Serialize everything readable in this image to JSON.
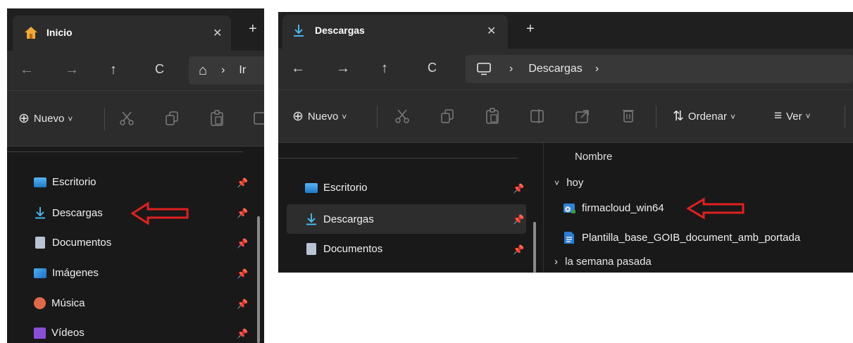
{
  "left_window": {
    "tab": {
      "title": "Inicio",
      "icon": "home-icon",
      "close_glyph": "✕",
      "newtab_glyph": "+"
    },
    "nav": {
      "back": "←",
      "forward": "→",
      "up": "↑",
      "refresh": "C",
      "home_glyph": "⌂",
      "chevron": "›",
      "path_partial": "Ir"
    },
    "toolbar": {
      "new_label": "Nuevo",
      "new_glyph": "⊕",
      "chevron": "˅"
    },
    "navpane": [
      {
        "label": "Escritorio",
        "icon": "desktop-folder-icon",
        "color": "#3aa0e8"
      },
      {
        "label": "Descargas",
        "icon": "downloads-icon",
        "color": "#4cc2ff"
      },
      {
        "label": "Documentos",
        "icon": "documents-folder-icon",
        "color": "#b8c4d4"
      },
      {
        "label": "Imágenes",
        "icon": "pictures-folder-icon",
        "color": "#2f8fe0"
      },
      {
        "label": "Música",
        "icon": "music-folder-icon",
        "color": "#e0694a"
      },
      {
        "label": "Vídeos",
        "icon": "videos-folder-icon",
        "color": "#8a4fd8"
      }
    ]
  },
  "right_window": {
    "tab": {
      "title": "Descargas",
      "icon": "downloads-icon",
      "close_glyph": "✕",
      "newtab_glyph": "+"
    },
    "nav": {
      "back": "←",
      "forward": "→",
      "up": "↑",
      "refresh": "C",
      "pc_glyph": "🖵",
      "chevron": "›",
      "crumb": "Descargas"
    },
    "toolbar": {
      "new_label": "Nuevo",
      "new_glyph": "⊕",
      "sort_label": "Ordenar",
      "sort_glyph": "⇅",
      "view_label": "Ver",
      "view_glyph": "≡",
      "chevron": "˅"
    },
    "navpane": [
      {
        "label": "Escritorio",
        "icon": "desktop-folder-icon",
        "color": "#3aa0e8"
      },
      {
        "label": "Descargas",
        "icon": "downloads-icon",
        "color": "#4cc2ff"
      },
      {
        "label": "Documentos",
        "icon": "documents-folder-icon",
        "color": "#b8c4d4"
      }
    ],
    "files": {
      "column_header": "Nombre",
      "group_today": "hoy",
      "group_today_glyph": "˅",
      "group_last_week": "la semana pasada",
      "group_last_week_glyph": "›",
      "items": [
        {
          "name": "firmacloud_win64",
          "icon": "installer-icon"
        },
        {
          "name": "Plantilla_base_GOIB_document_amb_portada",
          "icon": "word-document-icon"
        }
      ]
    }
  },
  "colors": {
    "accent": "#4cc2ff",
    "annotation_arrow": "#e02020",
    "window_bg": "#191919"
  }
}
